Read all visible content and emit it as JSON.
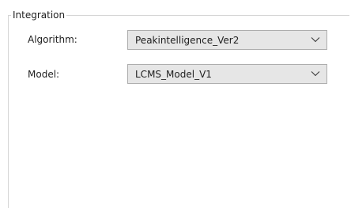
{
  "integration": {
    "group_title": "Integration",
    "algorithm": {
      "label": "Algorithm:",
      "value": "Peakintelligence_Ver2"
    },
    "model": {
      "label": "Model:",
      "value": "LCMS_Model_V1"
    }
  },
  "icons": {
    "dropdown": "chevron-down-icon"
  }
}
